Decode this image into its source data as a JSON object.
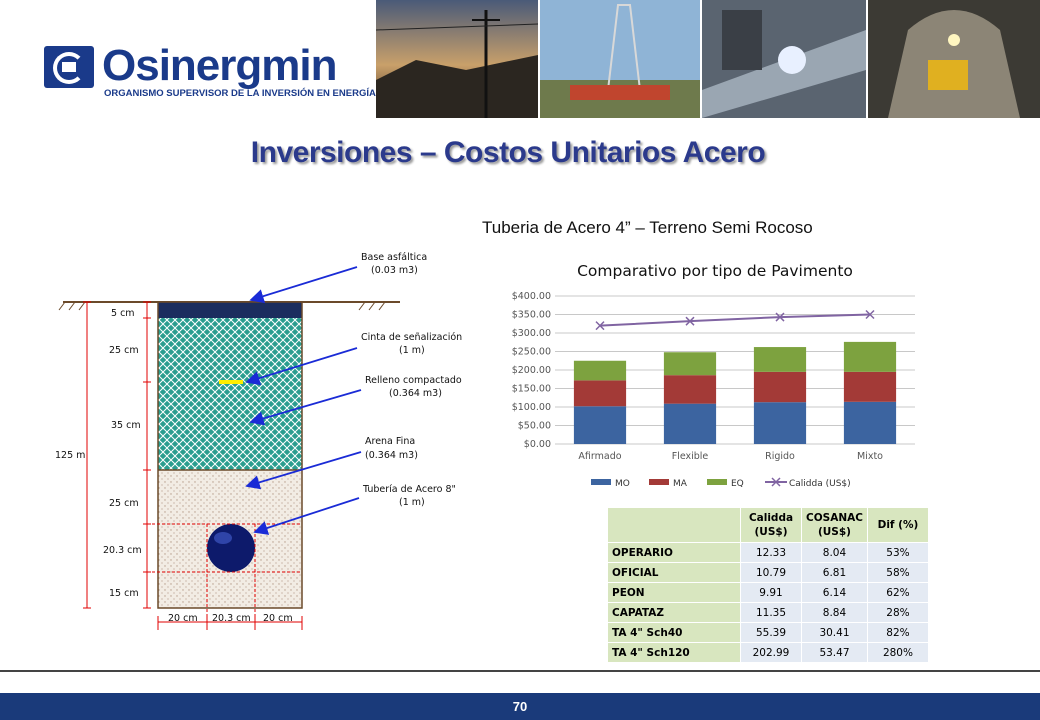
{
  "header": {
    "logo_name": "Osinergmin",
    "logo_subtitle": "ORGANISMO SUPERVISOR DE LA INVERSIÓN EN ENERGÍA Y MINERÍA"
  },
  "slide": {
    "title": "Inversiones – Costos Unitarios Acero",
    "subtitle": "Tuberia de Acero 4” – Terreno Semi Rocoso",
    "page_number": "70"
  },
  "diagram": {
    "labels": {
      "base_asfaltica": "Base asfáltica",
      "base_asfaltica_vol": "(0.03 m3)",
      "cinta": "Cinta de señalización",
      "cinta_len": "(1 m)",
      "relleno": "Relleno compactado",
      "relleno_vol": "(0.364 m3)",
      "arena": "Arena Fina",
      "arena_vol": "(0.364 m3)",
      "tuberia": "Tubería de Acero 8\"",
      "tuberia_len": "(1 m)"
    },
    "dims": {
      "d5": "5 cm",
      "d25a": "25 cm",
      "d35": "35 cm",
      "d25b": "25 cm",
      "d203v": "20.3 cm",
      "d15": "15 cm",
      "d125": "125 m",
      "w20a": "20 cm",
      "w203": "20.3 cm",
      "w20b": "20 cm"
    },
    "colors": {
      "asphalt": "#1b2d5e",
      "fill": "#2a9d8f",
      "sand": "#f2ece4",
      "pipe": "#0d1a6b",
      "tape": "#ffee00",
      "arrow": "#1a2bd6",
      "dim": "#e00000"
    }
  },
  "chart_data": {
    "type": "bar",
    "title": "Comparativo por tipo de Pavimento",
    "categories": [
      "Afirmado",
      "Flexible",
      "Rigido",
      "Mixto"
    ],
    "series": [
      {
        "name": "MO",
        "type": "bar",
        "color": "#3c64a0",
        "values": [
          102,
          109,
          113,
          114
        ]
      },
      {
        "name": "MA",
        "type": "bar",
        "color": "#a33a37",
        "values": [
          70,
          77,
          82,
          81
        ]
      },
      {
        "name": "EQ",
        "type": "bar",
        "color": "#7da23f",
        "values": [
          53,
          62,
          67,
          81
        ]
      },
      {
        "name": "Calidda (US$)",
        "type": "line",
        "color": "#8064a2",
        "values": [
          320,
          332,
          343,
          350
        ]
      }
    ],
    "yticks": [
      "$0.00",
      "$50.00",
      "$100.00",
      "$150.00",
      "$200.00",
      "$250.00",
      "$300.00",
      "$350.00",
      "$400.00"
    ],
    "ylim": [
      0,
      400
    ],
    "stacked": true,
    "grid": true,
    "legend": "bottom"
  },
  "table": {
    "headers": [
      "",
      "Calidda (US$)",
      "COSANAC (US$)",
      "Dif (%)"
    ],
    "rows": [
      {
        "label": "OPERARIO",
        "calidda": "12.33",
        "cosanac": "8.04",
        "dif": "53%"
      },
      {
        "label": "OFICIAL",
        "calidda": "10.79",
        "cosanac": "6.81",
        "dif": "58%"
      },
      {
        "label": "PEON",
        "calidda": "9.91",
        "cosanac": "6.14",
        "dif": "62%"
      },
      {
        "label": "CAPATAZ",
        "calidda": "11.35",
        "cosanac": "8.84",
        "dif": "28%"
      },
      {
        "label": "TA  4\" Sch40",
        "calidda": "55.39",
        "cosanac": "30.41",
        "dif": "82%"
      },
      {
        "label": "TA  4\" Sch120",
        "calidda": "202.99",
        "cosanac": "53.47",
        "dif": "280%"
      }
    ]
  }
}
